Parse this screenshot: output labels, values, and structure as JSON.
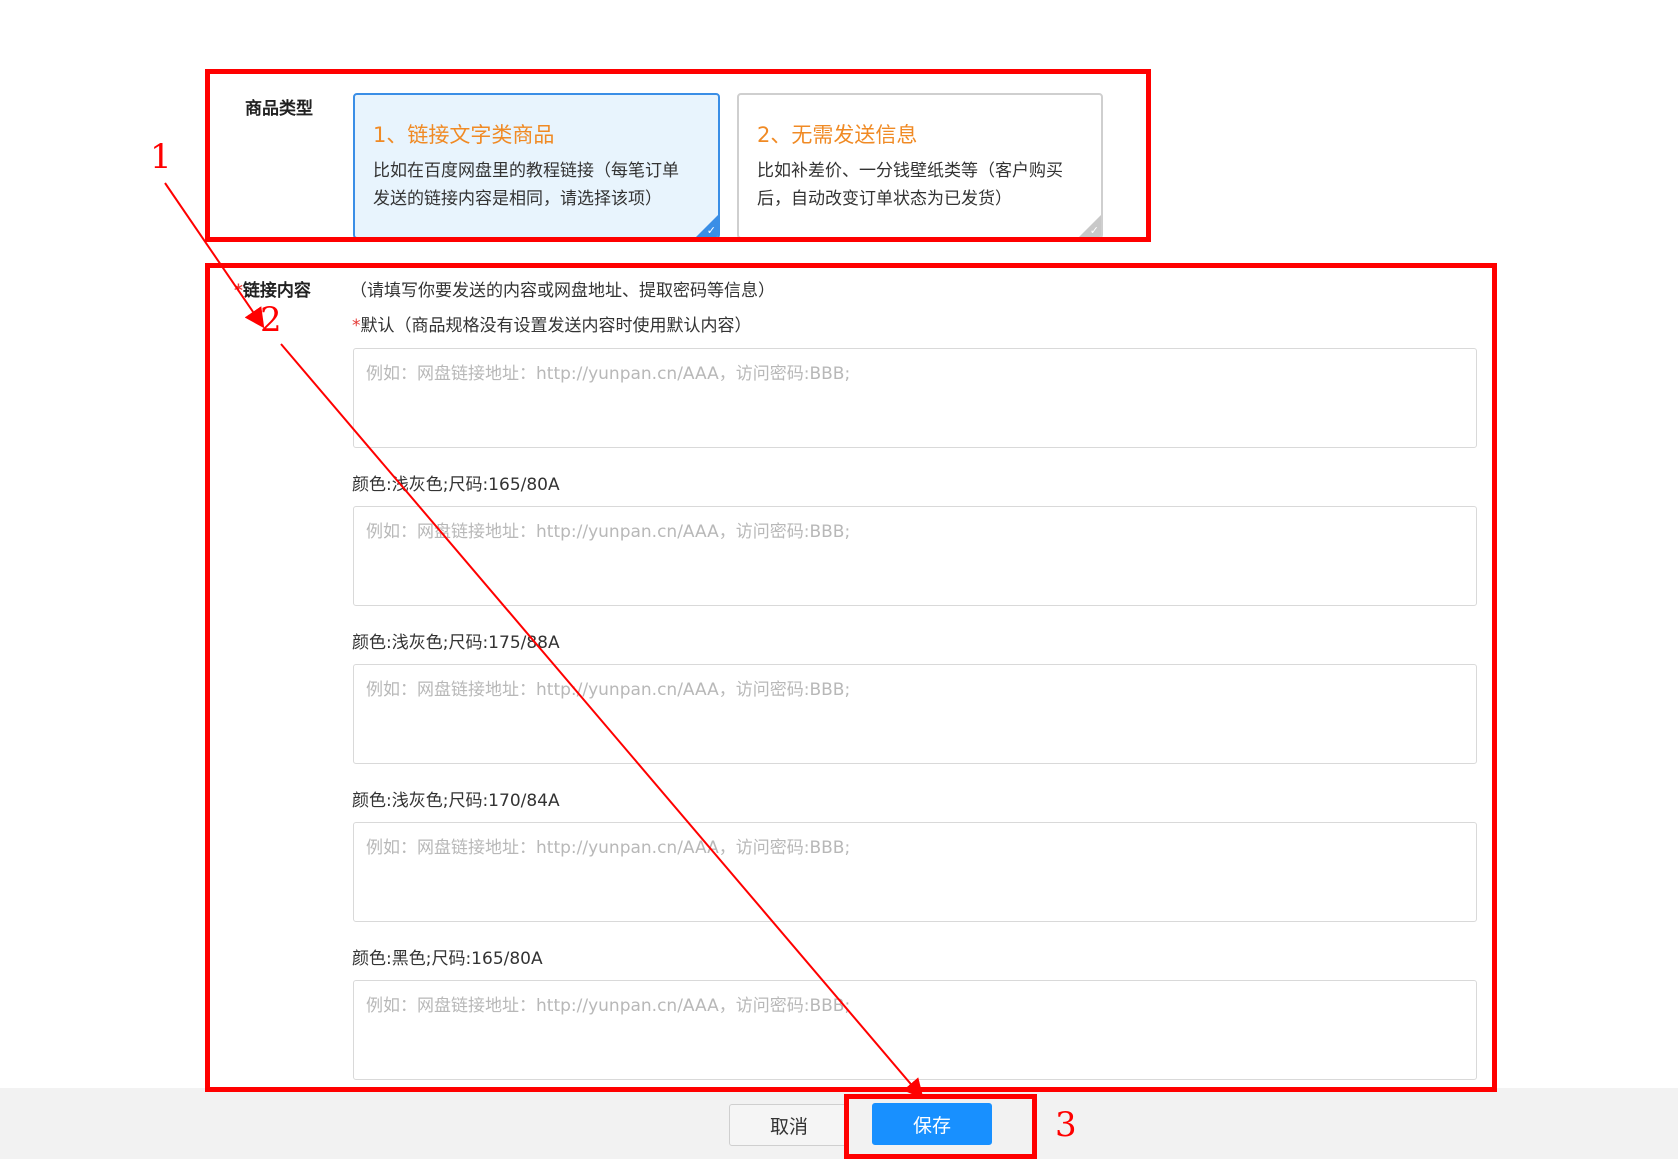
{
  "product_type": {
    "label": "商品类型",
    "options": [
      {
        "title": "1、链接文字类商品",
        "desc_line1": "比如在百度网盘里的教程链接（每笔订单",
        "desc_line2": "发送的链接内容是相同，请选择该项）",
        "selected": true
      },
      {
        "title": "2、无需发送信息",
        "desc_line1": "比如补差价、一分钱壁纸类等（客户购买",
        "desc_line2": "后，自动改变订单状态为已发货）",
        "selected": false
      }
    ]
  },
  "link_content": {
    "required_mark": "*",
    "label": "链接内容",
    "hint": "（请填写你要发送的内容或网盘地址、提取密码等信息）",
    "default_required_mark": "*",
    "default_label": "默认（商品规格没有设置发送内容时使用默认内容）",
    "placeholder": "例如：网盘链接地址：http://yunpan.cn/AAA，访问密码:BBB;",
    "specs": [
      "颜色:浅灰色;尺码:165/80A",
      "颜色:浅灰色;尺码:175/88A",
      "颜色:浅灰色;尺码:170/84A",
      "颜色:黑色;尺码:165/80A"
    ]
  },
  "footer": {
    "cancel_label": "取消",
    "save_label": "保存"
  },
  "annotations": {
    "color": "#ff0000",
    "step1": "1",
    "step2": "2",
    "step3": "3"
  },
  "colors": {
    "accent_blue": "#1890ff",
    "title_orange": "#f08a24",
    "selected_bg": "#e8f4fd"
  }
}
